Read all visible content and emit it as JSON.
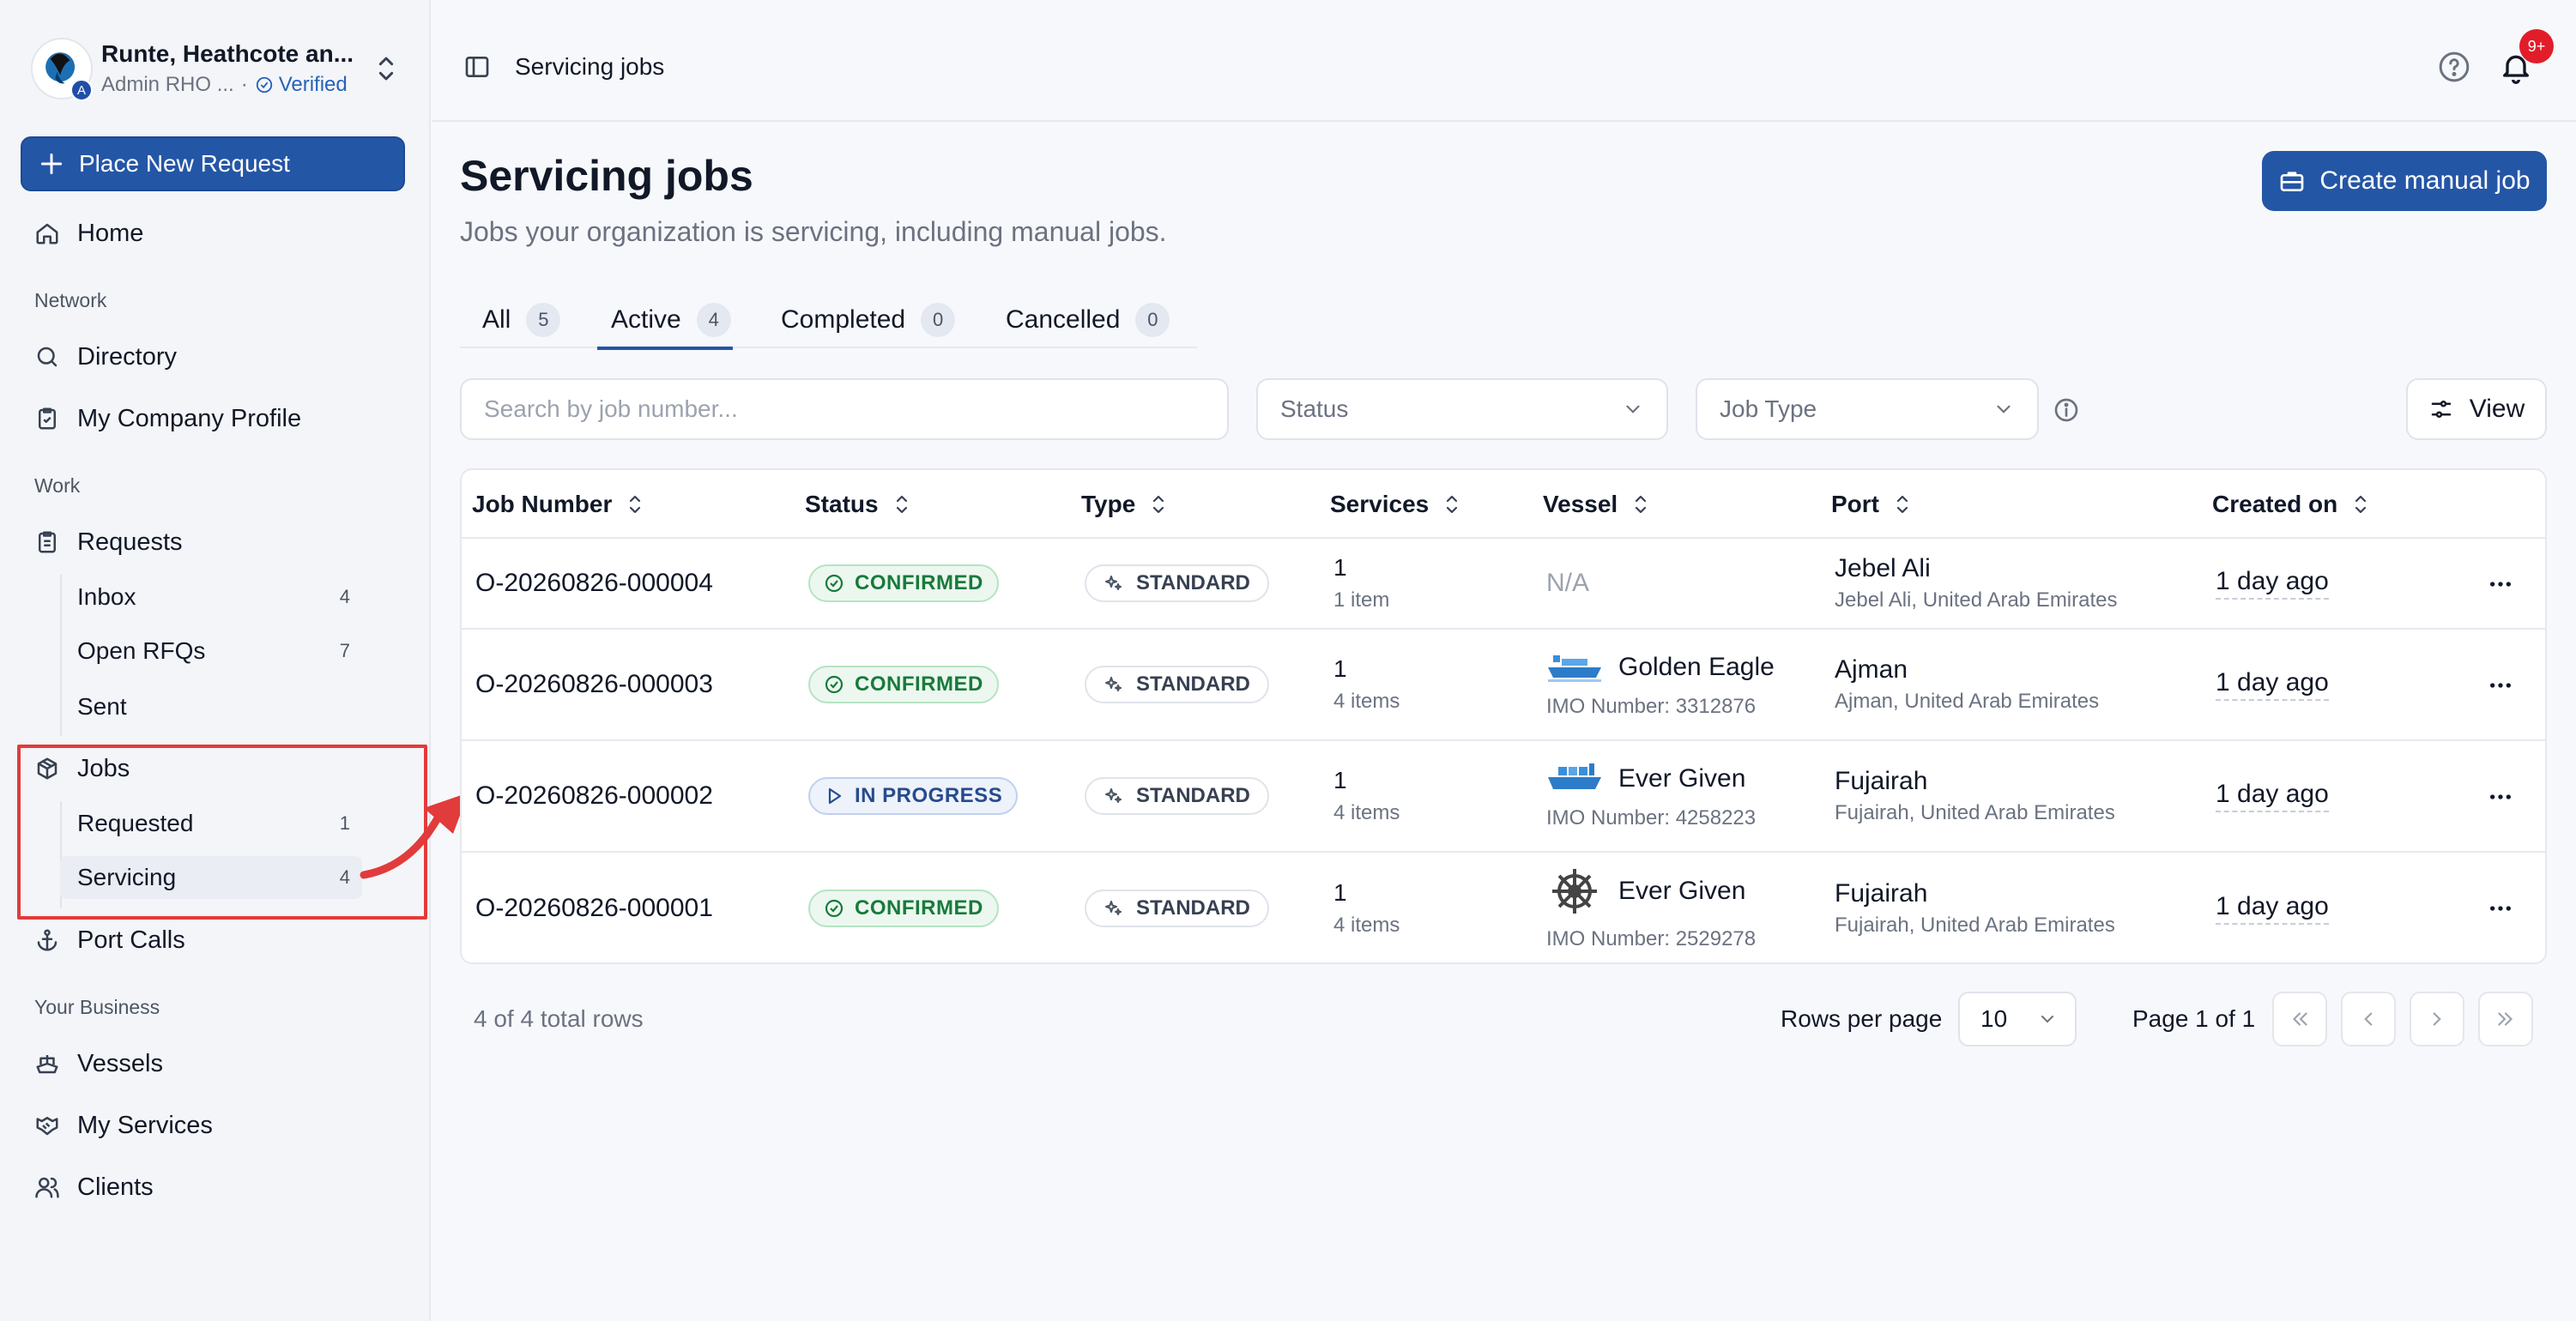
{
  "org": {
    "name": "Runte, Heathcote an...",
    "role": "Admin RHO ...",
    "separator": "·",
    "verified": "Verified",
    "badge_letter": "A"
  },
  "sidebar": {
    "place_request": "Place New Request",
    "home": "Home",
    "sections": {
      "network": "Network",
      "work": "Work",
      "business": "Your Business"
    },
    "directory": "Directory",
    "company_profile": "My Company Profile",
    "requests": "Requests",
    "request_items": [
      {
        "label": "Inbox",
        "count": "4"
      },
      {
        "label": "Open RFQs",
        "count": "7"
      },
      {
        "label": "Sent",
        "count": ""
      }
    ],
    "jobs": "Jobs",
    "job_items": [
      {
        "label": "Requested",
        "count": "1"
      },
      {
        "label": "Servicing",
        "count": "4"
      }
    ],
    "port_calls": "Port Calls",
    "vessels": "Vessels",
    "my_services": "My Services",
    "clients": "Clients"
  },
  "topbar": {
    "title": "Servicing jobs",
    "notification_count": "9+"
  },
  "page": {
    "title": "Servicing jobs",
    "subtitle": "Jobs your organization is servicing, including manual jobs.",
    "create_button": "Create manual job"
  },
  "tabs": [
    {
      "label": "All",
      "count": "5"
    },
    {
      "label": "Active",
      "count": "4"
    },
    {
      "label": "Completed",
      "count": "0"
    },
    {
      "label": "Cancelled",
      "count": "0"
    }
  ],
  "filters": {
    "search_placeholder": "Search by job number...",
    "status": "Status",
    "job_type": "Job Type",
    "view": "View"
  },
  "table": {
    "columns": [
      "Job Number",
      "Status",
      "Type",
      "Services",
      "Vessel",
      "Port",
      "Created on"
    ],
    "rows": [
      {
        "job_number": "O-20260826-000004",
        "status": "CONFIRMED",
        "type": "STANDARD",
        "services": "1",
        "items": "1 item",
        "vessel": "N/A",
        "imo": "",
        "port": "Jebel Ali",
        "port_full": "Jebel Ali, United Arab Emirates",
        "created": "1 day ago"
      },
      {
        "job_number": "O-20260826-000003",
        "status": "CONFIRMED",
        "type": "STANDARD",
        "services": "1",
        "items": "4 items",
        "vessel": "Golden Eagle",
        "imo": "IMO Number: 3312876",
        "port": "Ajman",
        "port_full": "Ajman, United Arab Emirates",
        "created": "1 day ago"
      },
      {
        "job_number": "O-20260826-000002",
        "status": "IN PROGRESS",
        "type": "STANDARD",
        "services": "1",
        "items": "4 items",
        "vessel": "Ever Given",
        "imo": "IMO Number: 4258223",
        "port": "Fujairah",
        "port_full": "Fujairah, United Arab Emirates",
        "created": "1 day ago"
      },
      {
        "job_number": "O-20260826-000001",
        "status": "CONFIRMED",
        "type": "STANDARD",
        "services": "1",
        "items": "4 items",
        "vessel": "Ever Given",
        "imo": "IMO Number: 2529278",
        "port": "Fujairah",
        "port_full": "Fujairah, United Arab Emirates",
        "created": "1 day ago"
      }
    ]
  },
  "footer": {
    "row_count": "4 of 4 total rows",
    "rows_per_page_label": "Rows per page",
    "rows_per_page": "10",
    "page_info": "Page 1 of 1"
  },
  "colors": {
    "brand": "#2456a6",
    "highlight": "#e23b3b",
    "confirmed": "#187a3c",
    "in_progress": "#274b8c"
  }
}
